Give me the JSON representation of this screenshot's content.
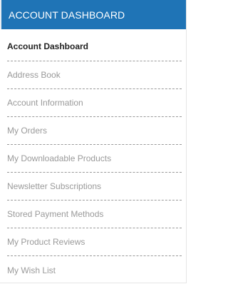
{
  "panel": {
    "title": "ACCOUNT DASHBOARD",
    "accent_color": "#1f74b6"
  },
  "menu": {
    "items": [
      {
        "label": "Account Dashboard",
        "active": true
      },
      {
        "label": "Address Book",
        "active": false
      },
      {
        "label": "Account Information",
        "active": false
      },
      {
        "label": "My Orders",
        "active": false
      },
      {
        "label": "My Downloadable Products",
        "active": false
      },
      {
        "label": "Newsletter Subscriptions",
        "active": false
      },
      {
        "label": "Stored Payment Methods",
        "active": false
      },
      {
        "label": "My Product Reviews",
        "active": false
      },
      {
        "label": "My Wish List",
        "active": false
      }
    ]
  }
}
